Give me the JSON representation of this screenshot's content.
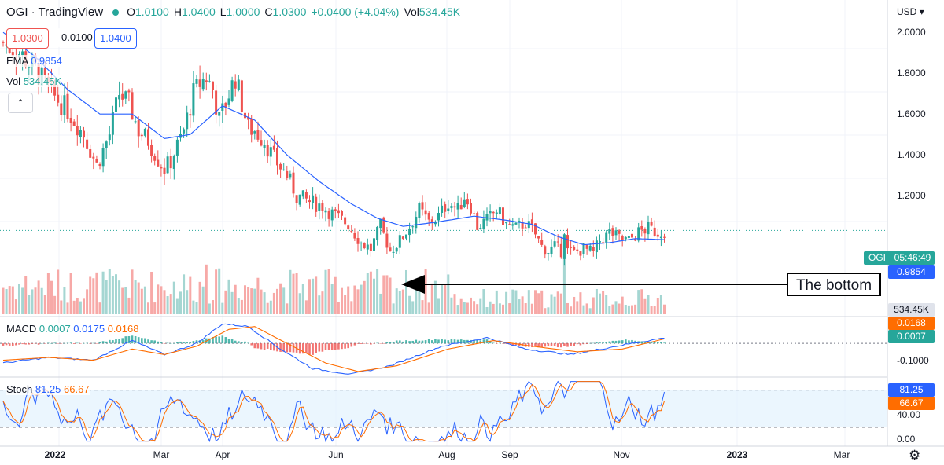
{
  "header": {
    "symbol": "OGI · TradingView",
    "open_label": "O",
    "open": "1.0100",
    "high_label": "H",
    "high": "1.0400",
    "low_label": "L",
    "low": "1.0000",
    "close_label": "C",
    "close": "1.0300",
    "change": "+0.0400 (+4.04%)",
    "vol_label": "Vol",
    "vol": "534.45K"
  },
  "price_boxes": {
    "sell": "1.0300",
    "spread": "0.0100",
    "buy": "1.0400"
  },
  "indicators": {
    "ema_label": "EMA",
    "ema_value": "0.9854",
    "vol_label": "Vol",
    "vol_value": "534.45K",
    "macd_label": "MACD",
    "macd_v1": "0.0007",
    "macd_v2": "0.0175",
    "macd_v3": "0.0168",
    "stoch_label": "Stoch",
    "stoch_k": "81.25",
    "stoch_d": "66.67"
  },
  "right_axis": {
    "currency": "USD",
    "price_ticks": [
      "2.0000",
      "1.8000",
      "1.6000",
      "1.4000",
      "1.2000"
    ],
    "macd_tick": "-0.1000",
    "stoch_ticks": [
      "40.00",
      "0.00"
    ]
  },
  "tags": {
    "symbol_tag": "OGI",
    "countdown": "05:46:49",
    "ema_tag": "0.9854",
    "vol_tag": "534.45K",
    "macd_tag1": "0.0168",
    "macd_tag2": "0.0007",
    "stoch_tag1": "81.25",
    "stoch_tag2": "66.67"
  },
  "x_axis": [
    "2022",
    "Mar",
    "Apr",
    "Jun",
    "Aug",
    "Sep",
    "Nov",
    "2023",
    "Mar"
  ],
  "annotation": "The bottom",
  "colors": {
    "up": "#26a69a",
    "down": "#ef5350",
    "ema": "#2962ff",
    "signal": "#ff6d00",
    "stoch_band": "#e3f2fd"
  },
  "icons": {
    "collapse": "chevron-up-icon",
    "settings": "gear-icon"
  },
  "chart_data": {
    "type": "candlestick",
    "price_anchors": [
      [
        0,
        1.95
      ],
      [
        5,
        1.9
      ],
      [
        10,
        1.82
      ],
      [
        15,
        1.7
      ],
      [
        20,
        1.62
      ],
      [
        25,
        1.5
      ],
      [
        29,
        1.35
      ],
      [
        33,
        1.5
      ],
      [
        36,
        1.7
      ],
      [
        39,
        1.65
      ],
      [
        42,
        1.52
      ],
      [
        45,
        1.47
      ],
      [
        48,
        1.38
      ],
      [
        50,
        1.33
      ],
      [
        52,
        1.37
      ],
      [
        56,
        1.52
      ],
      [
        59,
        1.7
      ],
      [
        61,
        1.75
      ],
      [
        63,
        1.78
      ],
      [
        65,
        1.72
      ],
      [
        67,
        1.57
      ],
      [
        70,
        1.7
      ],
      [
        72,
        1.78
      ],
      [
        74,
        1.65
      ],
      [
        76,
        1.53
      ],
      [
        78,
        1.52
      ],
      [
        81,
        1.47
      ],
      [
        84,
        1.38
      ],
      [
        88,
        1.3
      ],
      [
        91,
        1.2
      ],
      [
        95,
        1.17
      ],
      [
        99,
        1.15
      ],
      [
        103,
        1.1
      ],
      [
        107,
        1.06
      ],
      [
        111,
        0.97
      ],
      [
        114,
        0.94
      ],
      [
        117,
        1.05
      ],
      [
        120,
        0.93
      ],
      [
        123,
        0.98
      ],
      [
        126,
        1.05
      ],
      [
        129,
        1.13
      ],
      [
        132,
        1.07
      ],
      [
        135,
        1.1
      ],
      [
        138,
        1.17
      ],
      [
        141,
        1.13
      ],
      [
        143,
        1.2
      ],
      [
        145,
        1.15
      ],
      [
        147,
        1.05
      ],
      [
        150,
        1.08
      ],
      [
        153,
        1.13
      ],
      [
        156,
        1.06
      ],
      [
        159,
        1.04
      ],
      [
        162,
        1.07
      ],
      [
        165,
        1.01
      ],
      [
        167,
        0.95
      ],
      [
        169,
        0.93
      ],
      [
        171,
        0.95
      ],
      [
        173,
        0.93
      ],
      [
        174,
        1.04
      ],
      [
        175,
        0.93
      ],
      [
        177,
        0.92
      ],
      [
        180,
        0.94
      ],
      [
        183,
        0.92
      ],
      [
        185,
        0.98
      ],
      [
        188,
        1.02
      ],
      [
        191,
        0.99
      ],
      [
        194,
        0.98
      ],
      [
        197,
        1.02
      ],
      [
        200,
        1.04
      ],
      [
        203,
        1.02
      ],
      [
        205,
        1.03
      ]
    ],
    "ema_anchors": [
      [
        0,
        2.0
      ],
      [
        10,
        1.88
      ],
      [
        20,
        1.72
      ],
      [
        30,
        1.6
      ],
      [
        40,
        1.6
      ],
      [
        50,
        1.48
      ],
      [
        58,
        1.5
      ],
      [
        68,
        1.64
      ],
      [
        78,
        1.57
      ],
      [
        88,
        1.4
      ],
      [
        98,
        1.27
      ],
      [
        108,
        1.16
      ],
      [
        116,
        1.09
      ],
      [
        124,
        1.05
      ],
      [
        134,
        1.07
      ],
      [
        146,
        1.1
      ],
      [
        156,
        1.08
      ],
      [
        164,
        1.06
      ],
      [
        172,
        1.0
      ],
      [
        180,
        0.96
      ],
      [
        188,
        0.97
      ],
      [
        196,
        0.99
      ],
      [
        205,
        0.985
      ]
    ],
    "macd_anchors": [
      [
        0,
        -0.07
      ],
      [
        14,
        -0.05
      ],
      [
        28,
        -0.06
      ],
      [
        40,
        0.01
      ],
      [
        50,
        -0.04
      ],
      [
        60,
        0.0
      ],
      [
        68,
        0.07
      ],
      [
        76,
        0.06
      ],
      [
        86,
        -0.02
      ],
      [
        96,
        -0.09
      ],
      [
        108,
        -0.11
      ],
      [
        120,
        -0.08
      ],
      [
        136,
        -0.01
      ],
      [
        150,
        0.02
      ],
      [
        162,
        -0.02
      ],
      [
        176,
        -0.04
      ],
      [
        190,
        -0.01
      ],
      [
        205,
        0.02
      ]
    ],
    "signal_anchors": [
      [
        0,
        -0.06
      ],
      [
        14,
        -0.05
      ],
      [
        28,
        -0.06
      ],
      [
        40,
        -0.02
      ],
      [
        50,
        -0.04
      ],
      [
        60,
        -0.01
      ],
      [
        70,
        0.05
      ],
      [
        78,
        0.06
      ],
      [
        88,
        0.0
      ],
      [
        100,
        -0.07
      ],
      [
        110,
        -0.1
      ],
      [
        122,
        -0.08
      ],
      [
        138,
        -0.02
      ],
      [
        152,
        0.01
      ],
      [
        164,
        -0.01
      ],
      [
        178,
        -0.03
      ],
      [
        192,
        -0.02
      ],
      [
        205,
        0.016
      ]
    ],
    "ranges": {
      "price": [
        0.62,
        2.12
      ],
      "macd": [
        -0.12,
        0.09
      ],
      "stoch": [
        0,
        100
      ]
    },
    "bar_count": 206
  }
}
